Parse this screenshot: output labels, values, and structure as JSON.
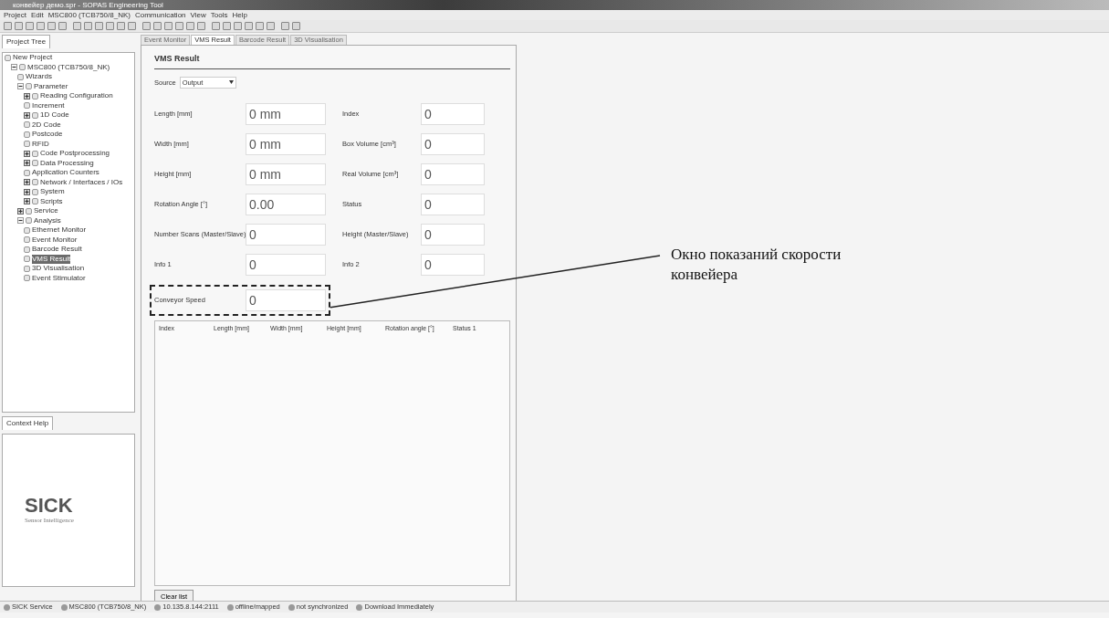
{
  "window": {
    "title": "конвейер демо.spr - SOPAS Engineering Tool"
  },
  "menu": [
    "Project",
    "Edit",
    "MSC800 (TCB750/8_NK)",
    "Communication",
    "View",
    "Tools",
    "Help"
  ],
  "project_tree": {
    "title": "Project Tree",
    "items": [
      {
        "label": "New Project",
        "children": [
          {
            "label": "MSC800 (TCB750/8_NK)",
            "expanded": true,
            "children": [
              {
                "label": "Wizards"
              },
              {
                "label": "Parameter",
                "expanded": true,
                "children": [
                  {
                    "label": "Reading Configuration",
                    "expanded": false
                  },
                  {
                    "label": "Increment"
                  },
                  {
                    "label": "1D Code",
                    "expanded": false
                  },
                  {
                    "label": "2D Code"
                  },
                  {
                    "label": "Postcode"
                  },
                  {
                    "label": "RFID"
                  },
                  {
                    "label": "Code Postprocessing",
                    "expanded": false
                  },
                  {
                    "label": "Data Processing",
                    "expanded": false
                  },
                  {
                    "label": "Application Counters"
                  },
                  {
                    "label": "Network / Interfaces / IOs",
                    "expanded": false
                  },
                  {
                    "label": "System",
                    "expanded": false
                  },
                  {
                    "label": "Scripts",
                    "expanded": false
                  }
                ]
              },
              {
                "label": "Service",
                "expanded": false
              },
              {
                "label": "Analysis",
                "expanded": true,
                "children": [
                  {
                    "label": "Ethernet Monitor",
                    "selected": false
                  },
                  {
                    "label": "Event Monitor",
                    "selected": false
                  },
                  {
                    "label": "Barcode Result",
                    "selected": false
                  },
                  {
                    "label": "VMS Result",
                    "selected": true
                  },
                  {
                    "label": "3D Visualisation",
                    "selected": false
                  },
                  {
                    "label": "Event Stimulator",
                    "selected": false
                  }
                ]
              }
            ]
          }
        ]
      }
    ]
  },
  "context_help": {
    "title": "Context Help",
    "logo": "SICK",
    "tagline": "Sensor Intelligence"
  },
  "tabs": [
    {
      "label": "Event Monitor",
      "selected": false
    },
    {
      "label": "VMS Result",
      "selected": true
    },
    {
      "label": "Barcode Result",
      "selected": false
    },
    {
      "label": "3D Visualisation",
      "selected": false
    }
  ],
  "panel": {
    "title": "VMS Result",
    "source": {
      "label": "Source",
      "value": "Output"
    },
    "fields": [
      {
        "label": "Length [mm]",
        "value": "0 mm"
      },
      {
        "label": "Index",
        "value": "0"
      },
      {
        "label": "Width [mm]",
        "value": "0 mm"
      },
      {
        "label": "Box Volume [cm³]",
        "value": "0"
      },
      {
        "label": "Height [mm]",
        "value": "0 mm"
      },
      {
        "label": "Real Volume [cm³]",
        "value": "0"
      },
      {
        "label": "Rotation Angle [°]",
        "value": "0.00"
      },
      {
        "label": "Status",
        "value": "0"
      },
      {
        "label": "Number Scans (Master/Slave)",
        "value": "0"
      },
      {
        "label": "Height (Master/Slave)",
        "value": "0"
      },
      {
        "label": "Info 1",
        "value": "0"
      },
      {
        "label": "Info 2",
        "value": "0"
      },
      {
        "label": "Conveyor Speed",
        "value": "0",
        "highlighted": true
      }
    ],
    "table": {
      "columns": [
        "Index",
        "Length [mm]",
        "Width [mm]",
        "Height [mm]",
        "Rotation angle [°]",
        "Status 1"
      ]
    },
    "clear_button": "Clear list"
  },
  "status_bar": [
    "SICK Service",
    "MSC800 (TCB750/8_NK)",
    "10.135.8.144:2111",
    "offline/mapped",
    "not synchronized",
    "Download Immediately"
  ],
  "annotation": "Окно показаний скорости конвейера"
}
